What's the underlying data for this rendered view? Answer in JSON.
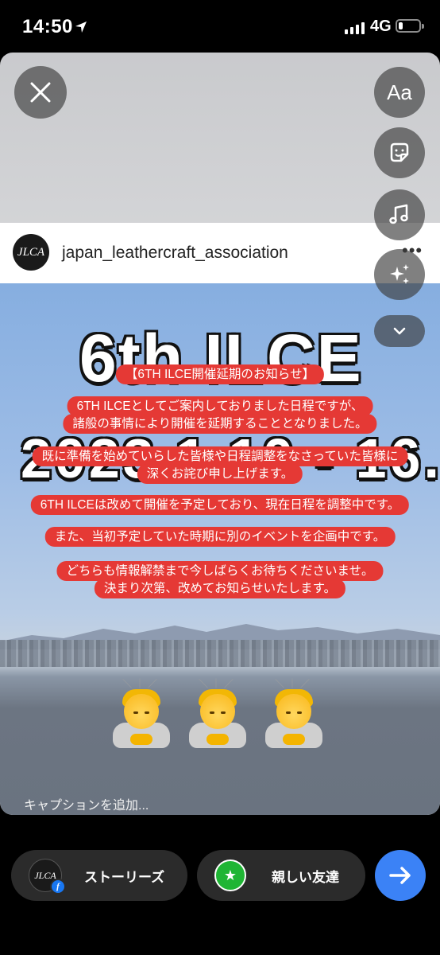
{
  "status_bar": {
    "time": "14:50",
    "network": "4G",
    "battery_percent": 20
  },
  "post": {
    "account_avatar_text": "JLCA",
    "username": "japan_leathercraft_association",
    "more": "•••"
  },
  "poster": {
    "title": "6th ILCE",
    "date_partial": "2023.1.10 - 16."
  },
  "notice_lines": [
    "【6TH ILCE開催延期のお知らせ】",
    "6TH ILCEとしてご案内しておりました日程ですが、",
    "諸般の事情により開催を延期することとなりました。",
    "既に準備を始めていらした皆様や日程調整をなさっていた皆様に",
    "深くお詫び申し上げます。",
    "6TH ILCEは改めて開催を予定しており、現在日程を調整中です。",
    "また、当初予定していた時期に別のイベントを企画中です。",
    "どちらも情報解禁まで今しばらくお待ちくださいませ。",
    "決まり次第、改めてお知らせいたします。"
  ],
  "emoji_count": 3,
  "caption_placeholder": "キャプションを追加...",
  "tools": {
    "text_label": "Aa"
  },
  "share": {
    "stories_label": "ストーリーズ",
    "close_friends_label": "親しい友達",
    "stories_avatar_text": "JLCA",
    "facebook_badge": "f",
    "close_friends_star": "★"
  },
  "colors": {
    "notice_bg": "#e53935",
    "send_button": "#3b82f6",
    "close_friends_green": "#1fb534"
  }
}
